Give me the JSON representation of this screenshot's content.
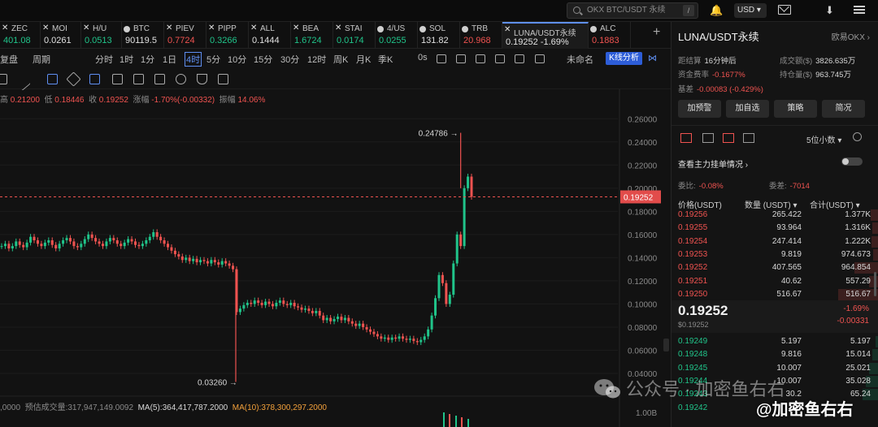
{
  "topbar": {
    "search_placeholder": "OKX BTC/USDT 永续",
    "search_shortcut": "/",
    "currency": "USD ▾"
  },
  "tabs": [
    {
      "name": "ZEC",
      "price": "401.08",
      "dir": "up",
      "icon": "close-icon"
    },
    {
      "name": "MOI",
      "price": "0.0261",
      "dir": "",
      "icon": "close-icon"
    },
    {
      "name": "H/U",
      "price": "0.0513",
      "dir": "up",
      "icon": "close-icon"
    },
    {
      "name": "BTC",
      "price": "90119.5",
      "dir": "",
      "icon": "coin-dot"
    },
    {
      "name": "PIEV",
      "price": "0.7724",
      "dir": "dn",
      "icon": "close-icon"
    },
    {
      "name": "PIPP",
      "price": "0.3266",
      "dir": "up",
      "icon": "close-icon"
    },
    {
      "name": "ALL",
      "price": "0.1444",
      "dir": "",
      "icon": "close-icon"
    },
    {
      "name": "BEA",
      "price": "1.6724",
      "dir": "up",
      "icon": "close-icon"
    },
    {
      "name": "STAI",
      "price": "0.0174",
      "dir": "up",
      "icon": "close-icon"
    },
    {
      "name": "4/US",
      "price": "0.0255",
      "dir": "up",
      "icon": "coin-dot"
    },
    {
      "name": "SOL",
      "price": "131.82",
      "dir": "",
      "icon": "coin-dot"
    },
    {
      "name": "TRB",
      "price": "20.968",
      "dir": "dn",
      "icon": "coin-dot"
    },
    {
      "name": "LUNA/USDT永续",
      "price": "0.19252  -1.69%",
      "dir": "",
      "icon": "close-icon",
      "active": true
    },
    {
      "name": "ALC",
      "price": "0.1883",
      "dir": "dn",
      "icon": "coin-dot"
    }
  ],
  "toolbar": {
    "left": "复盘",
    "period": "周期",
    "intervals": [
      "分时",
      "1时",
      "1分",
      "1日",
      "4时",
      "5分",
      "10分",
      "15分",
      "30分",
      "12时",
      "周K",
      "月K",
      "季K"
    ],
    "active_interval": "4时",
    "zero_s": "0s",
    "unnamed": "未命名",
    "kline_btn": "K线分析"
  },
  "ohlc": {
    "high_label": "高",
    "high": "0.21200",
    "low_label": "低",
    "low": "0.18446",
    "close_label": "收",
    "close": "0.19252",
    "chg_label": "涨幅",
    "chg": "-1.70%(-0.00332)",
    "amp_label": "振幅",
    "amp": "14.06%"
  },
  "volume_line": {
    "prefix": ",0000",
    "vol_label": "预估成交量",
    "vol": "317,947,149.0092",
    "ma5_label": "MA(5):",
    "ma5": "364,417,787.2000",
    "ma10_label": "MA(10):",
    "ma10": "378,300,297.2000"
  },
  "chart_data": {
    "type": "candlestick",
    "y_ticks": [
      "0.26000",
      "0.24000",
      "0.22000",
      "0.20000",
      "0.18000",
      "0.16000",
      "0.14000",
      "0.12000",
      "0.10000",
      "0.08000",
      "0.06000",
      "0.04000"
    ],
    "ylim": [
      0.04,
      0.27
    ],
    "current_price": "0.19252",
    "high_annotation": "0.24786",
    "low_annotation": "0.03260",
    "volume_tick": "1.00B",
    "series": [
      0.15,
      0.152,
      0.148,
      0.15,
      0.154,
      0.151,
      0.149,
      0.153,
      0.158,
      0.155,
      0.152,
      0.15,
      0.153,
      0.155,
      0.151,
      0.148,
      0.152,
      0.155,
      0.157,
      0.154,
      0.15,
      0.149,
      0.152,
      0.156,
      0.16,
      0.157,
      0.154,
      0.152,
      0.15,
      0.154,
      0.157,
      0.155,
      0.152,
      0.15,
      0.153,
      0.156,
      0.154,
      0.151,
      0.15,
      0.152,
      0.155,
      0.158,
      0.162,
      0.158,
      0.155,
      0.152,
      0.149,
      0.146,
      0.143,
      0.141,
      0.138,
      0.14,
      0.137,
      0.139,
      0.136,
      0.138,
      0.137,
      0.135,
      0.138,
      0.136,
      0.134,
      0.137,
      0.135,
      0.133,
      0.13,
      0.093,
      0.096,
      0.099,
      0.101,
      0.1,
      0.103,
      0.101,
      0.099,
      0.102,
      0.1,
      0.098,
      0.101,
      0.103,
      0.1,
      0.099,
      0.101,
      0.098,
      0.097,
      0.095,
      0.096,
      0.094,
      0.092,
      0.094,
      0.09,
      0.086,
      0.088,
      0.085,
      0.087,
      0.089,
      0.086,
      0.088,
      0.085,
      0.083,
      0.081,
      0.083,
      0.08,
      0.078,
      0.076,
      0.074,
      0.072,
      0.07,
      0.071,
      0.069,
      0.071,
      0.07,
      0.072,
      0.07,
      0.069,
      0.07,
      0.068,
      0.067,
      0.069,
      0.072,
      0.078,
      0.09,
      0.105,
      0.125,
      0.118,
      0.1,
      0.108,
      0.135,
      0.16,
      0.15,
      0.2,
      0.21,
      0.19252
    ]
  },
  "panel": {
    "title": "LUNA/USDT永续",
    "exchange": "欧易OKX ›",
    "countdown_label": "距结算",
    "countdown": "16分钟后",
    "funding_label": "资金费率",
    "funding": "-0.1677%",
    "basis_label": "基差",
    "basis": "-0.00083 (-0.429%)",
    "turnover_label": "成交额($)",
    "turnover": "3826.635万",
    "oi_label": "持仓量($)",
    "oi": "963.745万",
    "buttons": [
      "加预警",
      "加自选",
      "策略",
      "简况"
    ],
    "decimals": "5位小数 ▾",
    "main_view": "查看主力挂单情况 ›",
    "weibi_label": "委比",
    "weibi": "-0.08%",
    "weicha_label": "委差",
    "weicha": "-7014",
    "col_price": "价格(USDT)",
    "col_qty": "数量 (USDT) ▾",
    "col_total": "合计(USDT) ▾",
    "asks": [
      {
        "price": "0.19256",
        "qty": "265.422",
        "total": "1.377K",
        "w": 10
      },
      {
        "price": "0.19255",
        "qty": "93.964",
        "total": "1.316K",
        "w": 8
      },
      {
        "price": "0.19254",
        "qty": "247.414",
        "total": "1.222K",
        "w": 9
      },
      {
        "price": "0.19253",
        "qty": "9.819",
        "total": "974.673",
        "w": 7
      },
      {
        "price": "0.19252",
        "qty": "407.565",
        "total": "964.854",
        "w": 30
      },
      {
        "price": "0.19251",
        "qty": "40.62",
        "total": "557.29",
        "w": 12
      },
      {
        "price": "0.19250",
        "qty": "516.67",
        "total": "516.67",
        "w": 50
      }
    ],
    "mid_price": "0.19252",
    "mid_sub": "$0.19252",
    "mid_pct": "-1.69%",
    "mid_chg": "-0.00331",
    "bids": [
      {
        "price": "0.19249",
        "qty": "5.197",
        "total": "5.197",
        "w": 4
      },
      {
        "price": "0.19248",
        "qty": "9.816",
        "total": "15.014",
        "w": 8
      },
      {
        "price": "0.19245",
        "qty": "10.007",
        "total": "25.021",
        "w": 12
      },
      {
        "price": "0.19244",
        "qty": "10.007",
        "total": "35.028",
        "w": 16
      },
      {
        "price": "0.19243",
        "qty": "30.2",
        "total": "65.24",
        "w": 20
      },
      {
        "price": "0.19242",
        "qty": "",
        "total": "",
        "w": 0
      }
    ]
  },
  "watermark": {
    "text1": "公众号 · 加密鱼右右",
    "text2": "@加密鱼右右"
  }
}
